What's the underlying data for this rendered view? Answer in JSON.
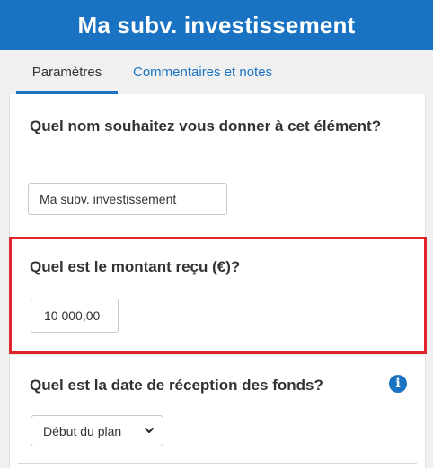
{
  "header": {
    "title": "Ma subv. investissement"
  },
  "tabs": [
    {
      "label": "Paramètres",
      "active": true
    },
    {
      "label": "Commentaires et notes",
      "active": false
    }
  ],
  "form": {
    "name_question": "Quel nom souhaitez vous donner à cet élément?",
    "name_value": "Ma subv. investissement",
    "amount_question": "Quel est le montant reçu (€)?",
    "amount_value": "10 000,00",
    "date_question": "Quel est la date de réception des fonds?",
    "date_selected": "Début du plan",
    "info_icon": "info-icon"
  },
  "colors": {
    "header_bg": "#1a73c2",
    "accent": "#1a73c2",
    "highlight_border": "#e0242b",
    "panel_bg": "#ffffff",
    "page_bg": "#f0f0f0"
  }
}
